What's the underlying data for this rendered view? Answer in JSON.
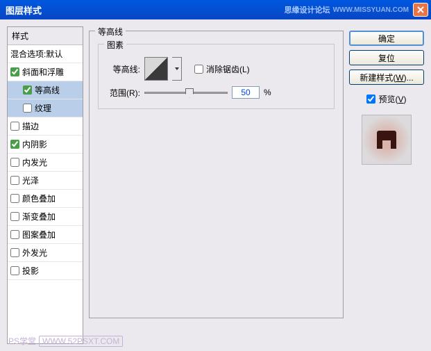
{
  "titlebar": {
    "title": "图层样式",
    "brand": "思缘设计论坛",
    "url": "WWW.MISSYUAN.COM"
  },
  "styles": {
    "header": "样式",
    "items": [
      {
        "label": "混合选项:默认",
        "checked": false,
        "hasCheckbox": false
      },
      {
        "label": "斜面和浮雕",
        "checked": true,
        "hasCheckbox": true
      },
      {
        "label": "等高线",
        "checked": true,
        "hasCheckbox": true,
        "child": true,
        "selected": true
      },
      {
        "label": "纹理",
        "checked": false,
        "hasCheckbox": true,
        "child": true,
        "selected": true
      },
      {
        "label": "描边",
        "checked": false,
        "hasCheckbox": true
      },
      {
        "label": "内阴影",
        "checked": true,
        "hasCheckbox": true
      },
      {
        "label": "内发光",
        "checked": false,
        "hasCheckbox": true
      },
      {
        "label": "光泽",
        "checked": false,
        "hasCheckbox": true
      },
      {
        "label": "颜色叠加",
        "checked": false,
        "hasCheckbox": true
      },
      {
        "label": "渐变叠加",
        "checked": false,
        "hasCheckbox": true
      },
      {
        "label": "图案叠加",
        "checked": false,
        "hasCheckbox": true
      },
      {
        "label": "外发光",
        "checked": false,
        "hasCheckbox": true
      },
      {
        "label": "投影",
        "checked": false,
        "hasCheckbox": true
      }
    ]
  },
  "content": {
    "groupLabel": "等高线",
    "innerLabel": "图素",
    "contourLabel": "等高线:",
    "antialiasLabel": "消除锯齿(L)",
    "rangeLabel": "范围(R):",
    "rangeValue": "50",
    "rangeUnit": "%"
  },
  "buttons": {
    "ok": "确定",
    "cancel": "复位",
    "newStyle": "新建样式(W)...",
    "preview": "预览(V)"
  },
  "watermark": {
    "text": "PS学堂",
    "url": "WWW.52PSXT.COM"
  }
}
